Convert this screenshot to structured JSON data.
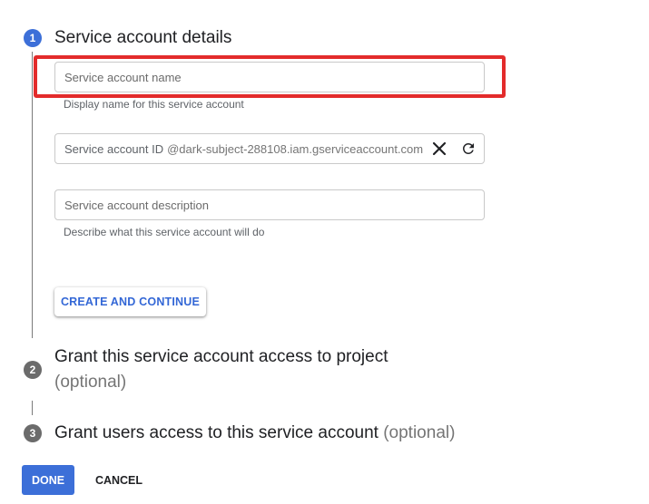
{
  "steps": [
    {
      "number": "1",
      "title": "Service account details",
      "optional": ""
    },
    {
      "number": "2",
      "title": "Grant this service account access to project",
      "optional": "(optional)"
    },
    {
      "number": "3",
      "title": "Grant users access to this service account",
      "optional": "(optional)"
    }
  ],
  "form": {
    "name": {
      "placeholder": "Service account name",
      "value": "",
      "hint": "Display name for this service account"
    },
    "id": {
      "label": "Service account ID",
      "suffix": "@dark-subject-288108.iam.gserviceaccount.com"
    },
    "description": {
      "placeholder": "Service account description",
      "value": "",
      "hint": "Describe what this service account will do"
    }
  },
  "buttons": {
    "create_continue": "CREATE AND CONTINUE",
    "done": "DONE",
    "cancel": "CANCEL"
  },
  "icons": {
    "clear": "close-icon",
    "refresh": "refresh-icon"
  },
  "colors": {
    "accent": "#3c6fd8",
    "highlight": "#e32b2b",
    "link": "#3367d6"
  }
}
